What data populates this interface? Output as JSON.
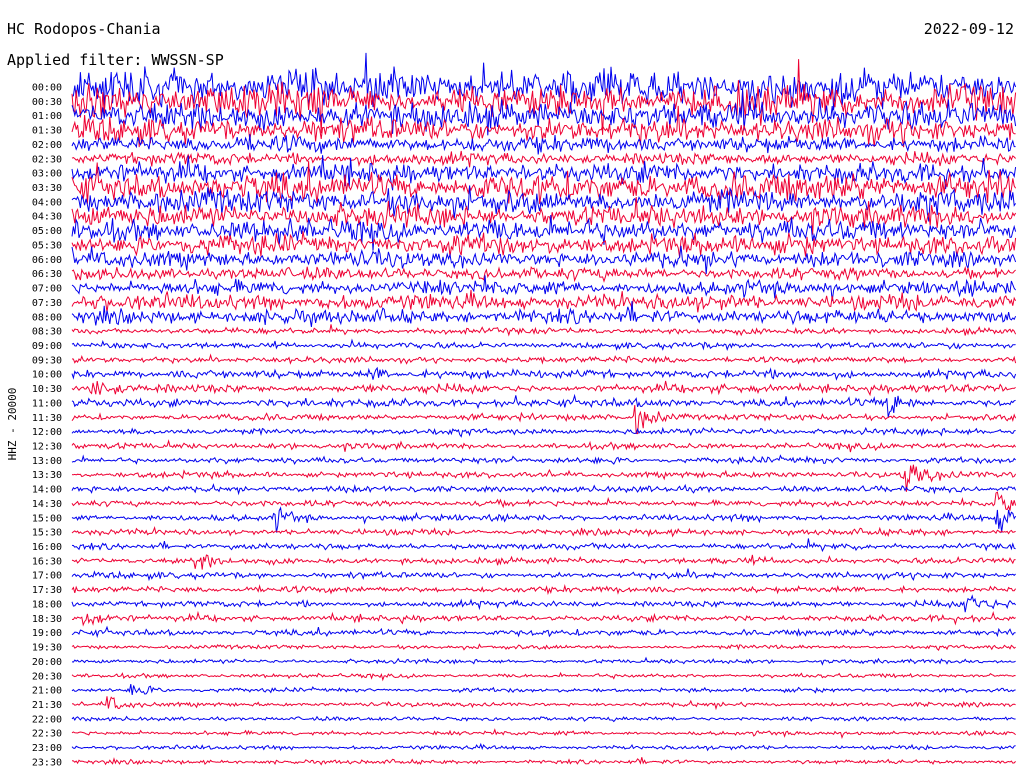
{
  "header": {
    "station": "HC Rodopos-Chania",
    "date": "2022-09-12",
    "filter_label": "Applied filter: WWSSN-SP"
  },
  "chart_data": {
    "type": "line",
    "title": "HC Rodopos-Chania",
    "ylabel": "HHZ - 20000",
    "rows": [
      "00:00",
      "00:30",
      "01:00",
      "01:30",
      "02:00",
      "02:30",
      "03:00",
      "03:30",
      "04:00",
      "04:30",
      "05:00",
      "05:30",
      "06:00",
      "06:30",
      "07:00",
      "07:30",
      "08:00",
      "08:30",
      "09:00",
      "09:30",
      "10:00",
      "10:30",
      "11:00",
      "11:30",
      "12:00",
      "12:30",
      "13:00",
      "13:30",
      "14:00",
      "14:30",
      "15:00",
      "15:30",
      "16:00",
      "16:30",
      "17:00",
      "17:30",
      "18:00",
      "18:30",
      "19:00",
      "19:30",
      "20:00",
      "20:30",
      "21:00",
      "21:30",
      "22:00",
      "22:30",
      "23:00",
      "23:30"
    ],
    "series_colors": [
      "#0000ee",
      "#ee0033"
    ],
    "noise_amplitude": [
      18,
      16,
      14,
      12,
      8,
      6,
      10,
      14,
      12,
      11,
      11,
      10,
      8,
      6,
      7,
      8,
      7,
      3,
      3,
      3,
      4,
      4,
      4,
      3,
      3,
      3,
      3,
      3,
      3,
      3,
      3,
      3,
      3,
      3,
      3,
      3,
      3,
      3,
      3,
      2,
      2,
      2,
      2,
      2,
      2,
      2,
      2,
      2
    ],
    "events": [
      {
        "row": "11:00",
        "minute": 26,
        "amplitude": 10
      },
      {
        "row": "11:30",
        "minute": 18,
        "amplitude": 14
      },
      {
        "row": "13:30",
        "minute": 26.5,
        "amplitude": 18
      },
      {
        "row": "14:30",
        "minute": 29.5,
        "amplitude": 14
      },
      {
        "row": "15:00",
        "minute": 6.5,
        "amplitude": 8
      },
      {
        "row": "15:00",
        "minute": 29.5,
        "amplitude": 10
      },
      {
        "row": "18:00",
        "minute": 28.5,
        "amplitude": 12
      },
      {
        "row": "18:30",
        "minute": 0.5,
        "amplitude": 9
      },
      {
        "row": "16:30",
        "minute": 4,
        "amplitude": 8
      },
      {
        "row": "21:00",
        "minute": 2,
        "amplitude": 6
      },
      {
        "row": "21:30",
        "minute": 1.2,
        "amplitude": 7
      },
      {
        "row": "10:30",
        "minute": 0.6,
        "amplitude": 9
      },
      {
        "row": "10:00",
        "minute": 9.5,
        "amplitude": 7
      }
    ]
  }
}
